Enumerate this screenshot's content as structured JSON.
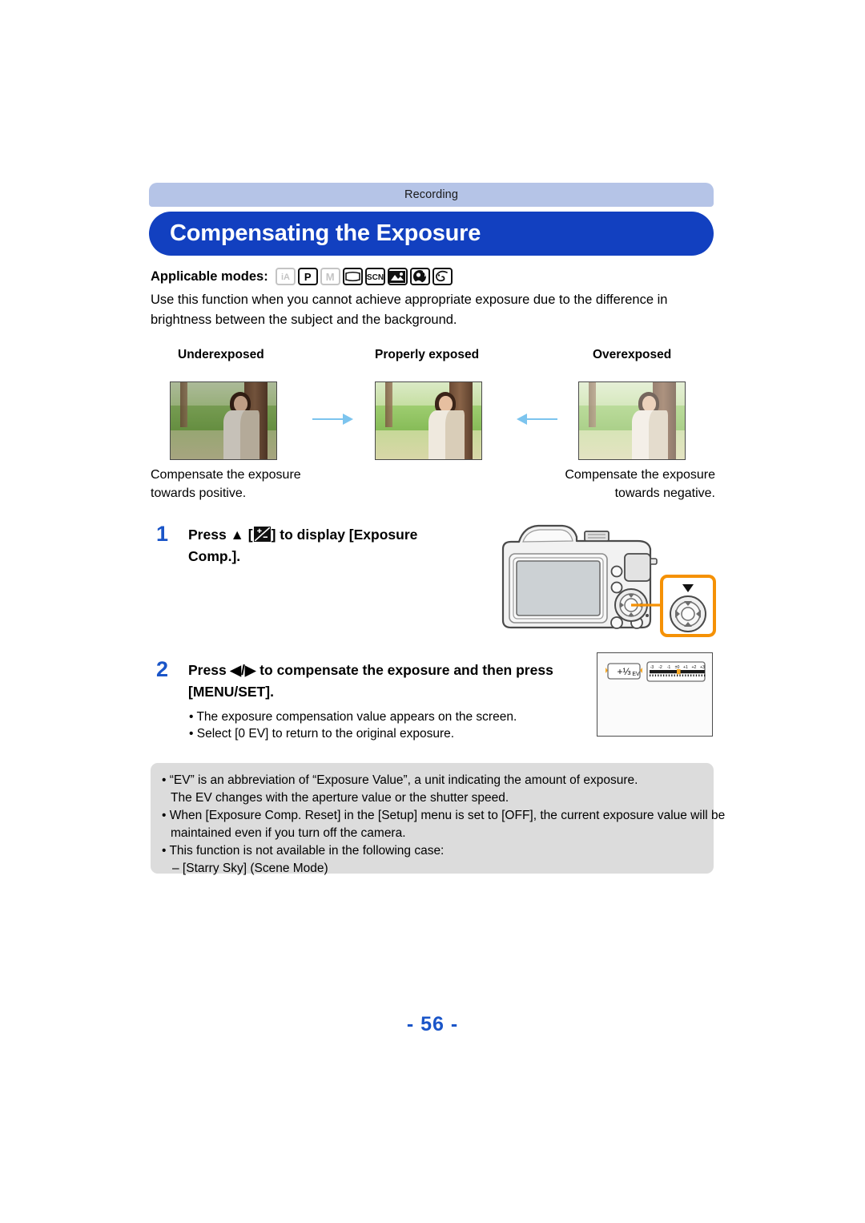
{
  "header": {
    "section": "Recording",
    "title": "Compensating the Exposure"
  },
  "applicable_modes": {
    "label": "Applicable modes:",
    "icons": [
      {
        "name": "intelligent-auto-mode-icon",
        "glyph": "iA",
        "enabled": false
      },
      {
        "name": "program-ae-mode-icon",
        "glyph": "P",
        "enabled": true
      },
      {
        "name": "manual-exposure-mode-icon",
        "glyph": "M",
        "enabled": false
      },
      {
        "name": "panorama-shot-mode-icon",
        "glyph": "panorama",
        "enabled": true
      },
      {
        "name": "scene-mode-icon",
        "glyph": "SCN",
        "enabled": true
      },
      {
        "name": "scenery-mode-icon",
        "glyph": "mountain",
        "enabled": true
      },
      {
        "name": "portrait-night-mode-icon",
        "glyph": "portrait",
        "enabled": true
      },
      {
        "name": "creative-control-mode-icon",
        "glyph": "palette",
        "enabled": true
      }
    ]
  },
  "intro": "Use this function when you cannot achieve appropriate exposure due to the difference in brightness between the subject and the background.",
  "examples": {
    "labels": [
      "Underexposed",
      "Properly exposed",
      "Overexposed"
    ],
    "caption_left": "Compensate the exposure towards positive.",
    "caption_right": "Compensate the exposure towards negative.",
    "arrow_color": "#7cc4ee"
  },
  "steps": [
    {
      "number": "1",
      "text_before_icon": "Press ▲ [",
      "icon": "exposure-compensation-icon",
      "text_after_icon": "] to display [Exposure Comp.].",
      "full_text": "Press ▲ [+/-] to display [Exposure Comp.]."
    },
    {
      "number": "2",
      "full_text": "Press ◀/▶ to compensate the exposure and then press [MENU/SET].",
      "bullets": [
        "• The exposure compensation value appears on the screen.",
        "• Select [0 EV] to return to the original exposure."
      ]
    }
  ],
  "camera_callout": {
    "name": "cursor-button-callout",
    "direction": "▲",
    "accent_color": "#f59105"
  },
  "screen_figure": {
    "ev_value": "+⅓ EV",
    "scale_labels": [
      "-3",
      "-2",
      "-1",
      "±0",
      "+1",
      "+2",
      "+3"
    ],
    "marker_position_ev": 0.33,
    "marker_color": "#f5a623"
  },
  "notes": [
    "• “EV” is an abbreviation of “Exposure Value”, a unit indicating the amount of exposure.",
    "The EV changes with the aperture value or the shutter speed.",
    "• When [Exposure Comp. Reset] in the [Setup] menu is set to [OFF], the current exposure value will be",
    "maintained even if you turn off the camera.",
    "• This function is not available in the following case:",
    "– [Starry Sky] (Scene Mode)"
  ],
  "page_number": "- 56 -",
  "colors": {
    "title_bar": "#1240c0",
    "section_bar": "#b5c4e7",
    "accent_blue": "#1a55c8",
    "notes_bg": "#dcdcdc",
    "callout_orange": "#f59105"
  }
}
